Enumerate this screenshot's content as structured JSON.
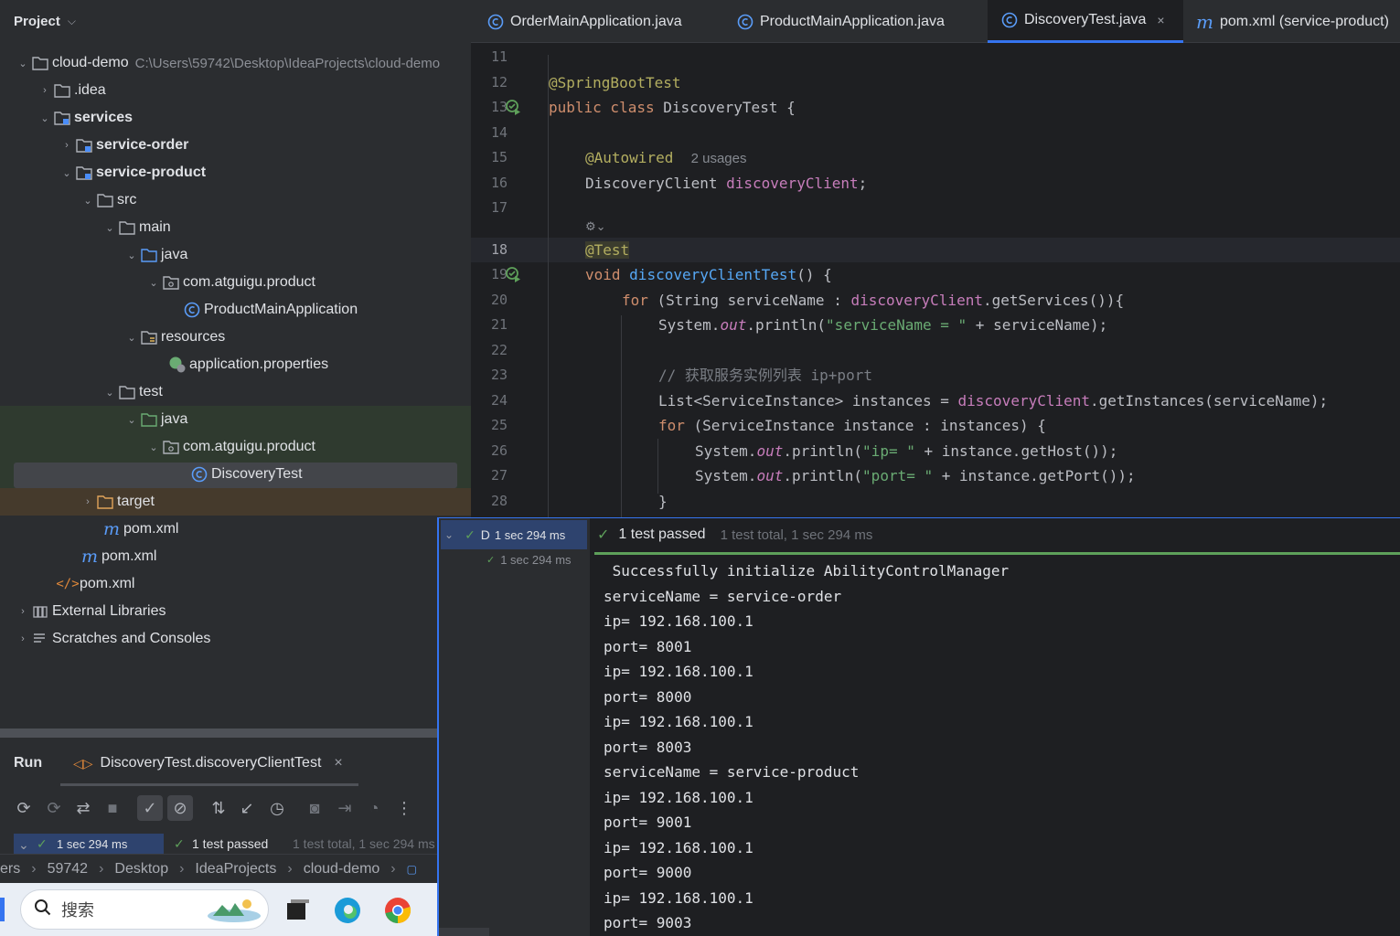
{
  "project": {
    "title": "Project",
    "tree": [
      {
        "label": "cloud-demo",
        "path": "C:\\Users\\59742\\Desktop\\IdeaProjects\\cloud-demo",
        "icon": "module-folder-icon"
      },
      {
        "label": ".idea",
        "icon": "folder-icon"
      },
      {
        "label": "services",
        "icon": "module-folder-icon"
      },
      {
        "label": "service-order",
        "icon": "module-folder-icon"
      },
      {
        "label": "service-product",
        "icon": "module-folder-icon"
      },
      {
        "label": "src",
        "icon": "folder-icon"
      },
      {
        "label": "main",
        "icon": "folder-icon"
      },
      {
        "label": "java",
        "icon": "source-folder-icon"
      },
      {
        "label": "com.atguigu.product",
        "icon": "package-icon"
      },
      {
        "label": "ProductMainApplication",
        "icon": "java-class-icon"
      },
      {
        "label": "resources",
        "icon": "resources-folder-icon"
      },
      {
        "label": "application.properties",
        "icon": "spring-properties-icon"
      },
      {
        "label": "test",
        "icon": "folder-icon"
      },
      {
        "label": "java",
        "icon": "test-source-folder-icon"
      },
      {
        "label": "com.atguigu.product",
        "icon": "package-icon"
      },
      {
        "label": "DiscoveryTest",
        "icon": "java-class-icon"
      },
      {
        "label": "target",
        "icon": "excluded-folder-icon"
      },
      {
        "label": "pom.xml",
        "icon": "maven-icon"
      },
      {
        "label": "pom.xml",
        "icon": "maven-icon"
      },
      {
        "label": "pom.xml",
        "icon": "xml-icon"
      },
      {
        "label": "External Libraries",
        "icon": "libraries-icon"
      },
      {
        "label": "Scratches and Consoles",
        "icon": "scratches-icon"
      }
    ]
  },
  "editor": {
    "tabs": [
      {
        "label": "OrderMainApplication.java",
        "icon": "java-class-icon"
      },
      {
        "label": "ProductMainApplication.java",
        "icon": "java-class-icon"
      },
      {
        "label": "DiscoveryTest.java",
        "icon": "java-class-icon",
        "close": "×"
      },
      {
        "label": "pom.xml (service-product)",
        "icon": "maven-icon"
      }
    ],
    "line_numbers": [
      "11",
      "12",
      "13",
      "14",
      "15",
      "16",
      "17",
      "",
      "18",
      "19",
      "20",
      "21",
      "22",
      "23",
      "24",
      "25",
      "26",
      "27",
      "28"
    ],
    "autowired_hint": "2 usages",
    "code": {
      "l12": "@SpringBootTest",
      "l13_kw": "public class",
      "l13_rest": " DiscoveryTest {",
      "l15": "@Autowired",
      "l16_type": "DiscoveryClient ",
      "l16_field": "discoveryClient",
      "l16_end": ";",
      "l18": "@Test",
      "l19_kw": "void ",
      "l19_m": "discoveryClientTest",
      "l19_end": "() {",
      "l20_kw": "for",
      "l20_a": " (String serviceName : ",
      "l20_f": "discoveryClient",
      "l20_b": ".getServices()){",
      "l21_a": "System.",
      "l21_out": "out",
      "l21_b": ".println(",
      "l21_s": "\"serviceName = \"",
      "l21_c": " + serviceName);",
      "l23": "// 获取服务实例列表 ip+port",
      "l24_a": "List<ServiceInstance> instances = ",
      "l24_f": "discoveryClient",
      "l24_b": ".getInstances(serviceName);",
      "l25_kw": "for",
      "l25_a": " (ServiceInstance instance : instances) {",
      "l26_a": "System.",
      "l26_out": "out",
      "l26_b": ".println(",
      "l26_s": "\"ip= \"",
      "l26_c": " + instance.getHost());",
      "l27_a": "System.",
      "l27_out": "out",
      "l27_b": ".println(",
      "l27_s": "\"port= \"",
      "l27_c": " + instance.getPort());",
      "l28": "}"
    }
  },
  "run": {
    "title": "Run",
    "tab_label": "DiscoveryTest.discoveryClientTest",
    "tab_close": "×",
    "strip_left": "1 sec 294 ms",
    "strip_status": "1 test passed",
    "strip_total": "1 test total, 1 sec 294 ms"
  },
  "breadcrumb": [
    "ers",
    "59742",
    "Desktop",
    "IdeaProjects",
    "cloud-demo"
  ],
  "taskbar": {
    "search_placeholder": "搜索"
  },
  "results": {
    "tree_root_label": "D",
    "tree_root_time": "1 sec 294 ms",
    "tree_child_time": "1 sec 294 ms",
    "status": "1 test passed",
    "summary": "1 test total, 1 sec 294 ms",
    "output": [
      " Successfully initialize AbilityControlManager",
      "serviceName = service-order",
      "ip= 192.168.100.1",
      "port= 8001",
      "ip= 192.168.100.1",
      "port= 8000",
      "ip= 192.168.100.1",
      "port= 8003",
      "serviceName = service-product",
      "ip= 192.168.100.1",
      "port= 9001",
      "ip= 192.168.100.1",
      "port= 9000",
      "ip= 192.168.100.1",
      "port= 9003"
    ]
  },
  "colors": {
    "accent": "#3574f0",
    "pass_green": "#5ea05a",
    "panel_bg": "#2b2d30",
    "editor_bg": "#1e1f22"
  }
}
